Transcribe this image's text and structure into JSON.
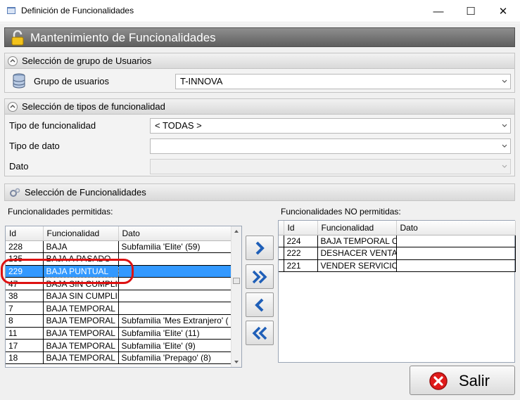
{
  "window": {
    "title": "Definición de Funcionalidades",
    "controls": {
      "minimize": "—",
      "maximize": "☐",
      "close": "✕"
    }
  },
  "header": {
    "title": "Mantenimiento de Funcionalidades",
    "icon": "lock-icon"
  },
  "user_group_section": {
    "title": "Selección de grupo de Usuarios",
    "label": "Grupo de usuarios",
    "value": "T-INNOVA"
  },
  "functionality_type_section": {
    "title": "Selección de tipos de funcionalidad",
    "type_label": "Tipo de funcionalidad",
    "type_value": "< TODAS >",
    "data_type_label": "Tipo de dato",
    "data_type_value": "",
    "data_label": "Dato",
    "data_value": ""
  },
  "functionality_section": {
    "title": "Selección de Funcionalidades",
    "allowed_title": "Funcionalidades permitidas:",
    "denied_title": "Funcionalidades NO permitidas:"
  },
  "allowed_grid": {
    "columns": [
      "Id",
      "Funcionalidad",
      "Dato"
    ],
    "rows": [
      [
        "228",
        "BAJA",
        "Subfamilia 'Elite' (59)"
      ],
      [
        "135",
        "BAJA A PASADO",
        ""
      ],
      [
        "229",
        "BAJA PUNTUAL",
        ""
      ],
      [
        "47",
        "BAJA SIN CUMPLIR",
        ""
      ],
      [
        "38",
        "BAJA SIN CUMPLIR",
        ""
      ],
      [
        "7",
        "BAJA TEMPORAL",
        ""
      ],
      [
        "8",
        "BAJA TEMPORAL",
        "Subfamilia 'Mes Extranjero' ("
      ],
      [
        "11",
        "BAJA TEMPORAL",
        "Subfamilia 'Elite' (11)"
      ],
      [
        "17",
        "BAJA TEMPORAL",
        "Subfamilia 'Elite' (9)"
      ],
      [
        "18",
        "BAJA TEMPORAL",
        "Subfamilia 'Prepago' (8)"
      ]
    ],
    "selected_index": 2
  },
  "denied_grid": {
    "columns": [
      "Id",
      "Funcionalidad",
      "Dato"
    ],
    "rows": [
      [
        "224",
        "BAJA TEMPORAL CO",
        ""
      ],
      [
        "222",
        "DESHACER VENTA S",
        ""
      ],
      [
        "221",
        "VENDER SERVICIO",
        ""
      ]
    ]
  },
  "exit_button": {
    "label": "Salir"
  },
  "colors": {
    "selection": "#3399ff",
    "header_band": "#6e6e6e",
    "move_arrows": "#1f5fb8",
    "exit_icon": "#e01b1b"
  }
}
